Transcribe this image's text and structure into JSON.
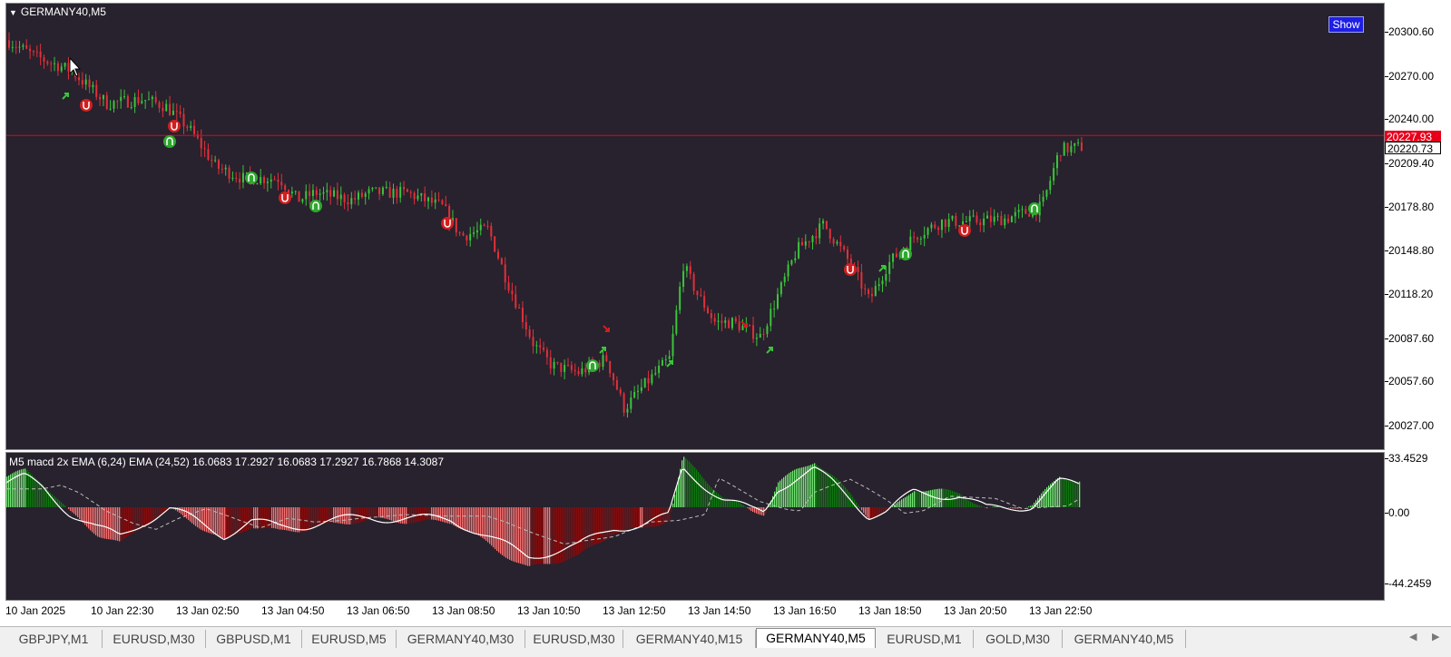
{
  "chart": {
    "symbol": "GERMANY40,M5",
    "show_button": "Show",
    "price_ticks": [
      "20300.60",
      "20270.00",
      "20240.00",
      "20209.40",
      "20178.80",
      "20148.80",
      "20118.20",
      "20087.60",
      "20057.60",
      "20027.00"
    ],
    "price_tick_values": [
      20300.6,
      20270.0,
      20240.0,
      20209.4,
      20178.8,
      20148.8,
      20118.2,
      20087.6,
      20057.6,
      20027.0
    ],
    "bid_price": "20227.93",
    "last_price": "20220.73",
    "colors": {
      "background": "#27222d",
      "bull": "#3cc43c",
      "bear": "#e0303a",
      "bid_line": "#e8001a",
      "signal_green": "#2fa82f",
      "signal_red": "#d11f1f"
    }
  },
  "indicator": {
    "label": "M5 macd 2x EMA (6,24) EMA (24,52)  16.0683 17.2927 16.0683 17.2927 16.7868 14.3087",
    "ticks": [
      "33.4529",
      "0.00",
      "-44.2459"
    ],
    "tick_values": [
      33.4529,
      0,
      -44.2459
    ]
  },
  "time_axis": [
    "10 Jan 2025",
    "10 Jan 22:30",
    "13 Jan 02:50",
    "13 Jan 04:50",
    "13 Jan 06:50",
    "13 Jan 08:50",
    "13 Jan 10:50",
    "13 Jan 12:50",
    "13 Jan 14:50",
    "13 Jan 16:50",
    "13 Jan 18:50",
    "13 Jan 20:50",
    "13 Jan 22:50"
  ],
  "tabs": [
    {
      "label": "GBPJPY,M1",
      "active": false
    },
    {
      "label": "EURUSD,M30",
      "active": false
    },
    {
      "label": "GBPUSD,M1",
      "active": false
    },
    {
      "label": "EURUSD,M5",
      "active": false
    },
    {
      "label": "GERMANY40,M30",
      "active": false
    },
    {
      "label": "EURUSD,M30",
      "active": false
    },
    {
      "label": "GERMANY40,M15",
      "active": false
    },
    {
      "label": "GERMANY40,M5",
      "active": true
    },
    {
      "label": "EURUSD,M1",
      "active": false
    },
    {
      "label": "GOLD,M30",
      "active": false
    },
    {
      "label": "GERMANY40,M5",
      "active": false
    }
  ],
  "icons": {
    "collapse": "triangle-down-icon",
    "tab_prev": "arrow-left-icon",
    "tab_next": "arrow-right-icon"
  }
}
